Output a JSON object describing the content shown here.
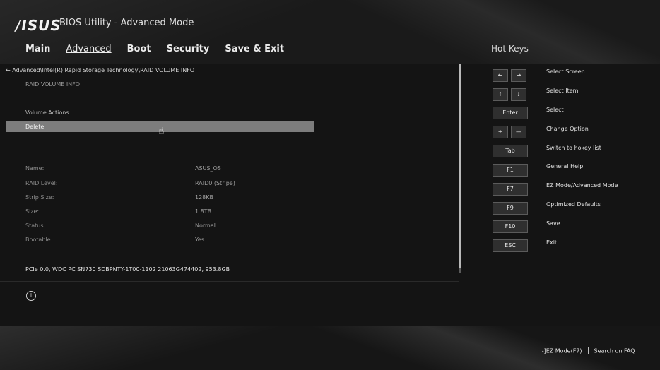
{
  "header": {
    "logo": "/ISUS",
    "title": "BIOS Utility - Advanced Mode",
    "menu": [
      "Main",
      "Advanced",
      "Boot",
      "Security",
      "Save & Exit"
    ],
    "active_menu": "Advanced",
    "hotkeys_title": "Hot Keys"
  },
  "content": {
    "back_arrow": "←",
    "breadcrumb": "Advanced\\Intel(R) Rapid Storage Technology\\RAID VOLUME INFO",
    "subtitle": "RAID VOLUME INFO",
    "volume_actions": "Volume Actions",
    "delete": "Delete",
    "info": [
      {
        "label": "Name:",
        "value": "ASUS_OS"
      },
      {
        "label": "RAID Level:",
        "value": "RAID0 (Stripe)"
      },
      {
        "label": "Strip Size:",
        "value": "128KB"
      },
      {
        "label": "Size:",
        "value": "1.8TB"
      },
      {
        "label": "Status:",
        "value": "Normal"
      },
      {
        "label": "Bootable:",
        "value": "Yes"
      }
    ],
    "device": "PCIe 0.0, WDC PC SN730 SDBPNTY-1T00-1102 21063G474402, 953.8GB",
    "info_icon": "i"
  },
  "hotkeys": [
    {
      "keys": [
        "←",
        "→"
      ],
      "desc": "Select Screen"
    },
    {
      "keys": [
        "↑",
        "↓"
      ],
      "desc": "Select Item"
    },
    {
      "keys": [
        "Enter"
      ],
      "desc": "Select"
    },
    {
      "keys": [
        "+",
        "—"
      ],
      "desc": "Change Option"
    },
    {
      "keys": [
        "Tab"
      ],
      "desc": "Switch to hokey list"
    },
    {
      "keys": [
        "F1"
      ],
      "desc": "General Help"
    },
    {
      "keys": [
        "F7"
      ],
      "desc": "EZ Mode/Advanced Mode"
    },
    {
      "keys": [
        "F9"
      ],
      "desc": "Optimized Defaults"
    },
    {
      "keys": [
        "F10"
      ],
      "desc": "Save"
    },
    {
      "keys": [
        "ESC"
      ],
      "desc": "Exit"
    }
  ],
  "footer": {
    "ez_mode": "|-]EZ Mode(F7)",
    "search": "Search on FAQ"
  }
}
